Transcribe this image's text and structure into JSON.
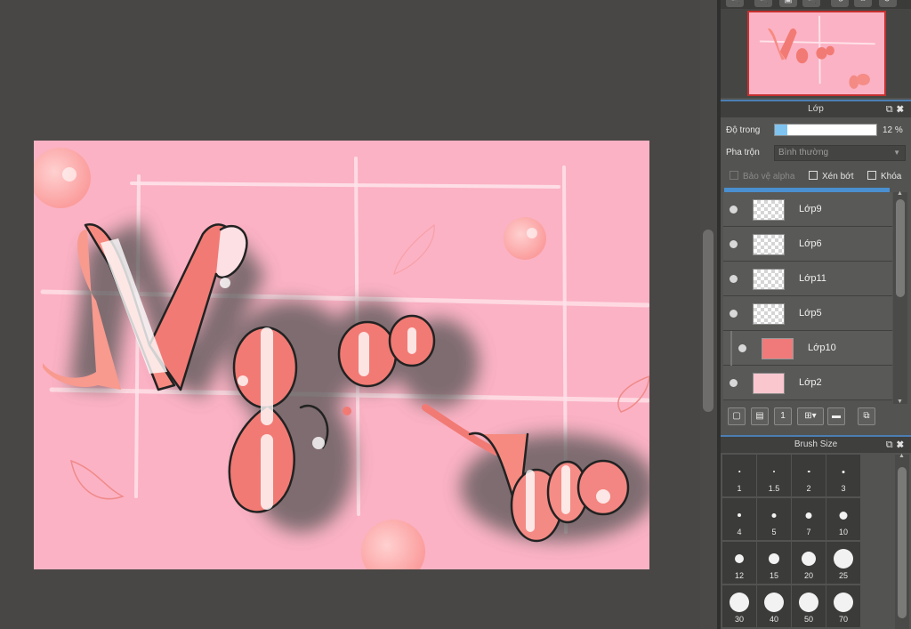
{
  "layer_panel": {
    "title": "Lớp",
    "opacity_label": "Độ trong",
    "opacity_value": "12 %",
    "opacity_fraction": 0.12,
    "blend_label": "Pha trộn",
    "blend_value": "Bình thường",
    "protect_alpha": "Bảo vệ alpha",
    "clipping": "Xén bớt",
    "lock": "Khóa",
    "layers": [
      {
        "name": "Lớp9",
        "visible": true,
        "clipped": false
      },
      {
        "name": "Lớp6",
        "visible": true,
        "clipped": false
      },
      {
        "name": "Lớp11",
        "visible": true,
        "clipped": false
      },
      {
        "name": "Lớp5",
        "visible": true,
        "clipped": false
      },
      {
        "name": "Lớp10",
        "visible": true,
        "clipped": true
      },
      {
        "name": "Lớp2",
        "visible": true,
        "clipped": false
      }
    ],
    "tools": [
      "new-layer-icon",
      "new-raster-icon",
      "new-halftone-icon",
      "add-layer-menu-icon",
      "folder-icon",
      "duplicate-icon"
    ]
  },
  "brush_panel": {
    "title": "Brush Size",
    "sizes": [
      "1",
      "1.5",
      "2",
      "3",
      "4",
      "5",
      "7",
      "10",
      "12",
      "15",
      "20",
      "25",
      "30",
      "40",
      "50",
      "70"
    ]
  },
  "canvas": {
    "artwork_text": [
      "Ngọc",
      "cute"
    ],
    "background_color": "#fbb2c4",
    "letter_color": "#f2706e"
  },
  "icons": {
    "panel_popout": "⧉",
    "panel_close": "✖"
  }
}
